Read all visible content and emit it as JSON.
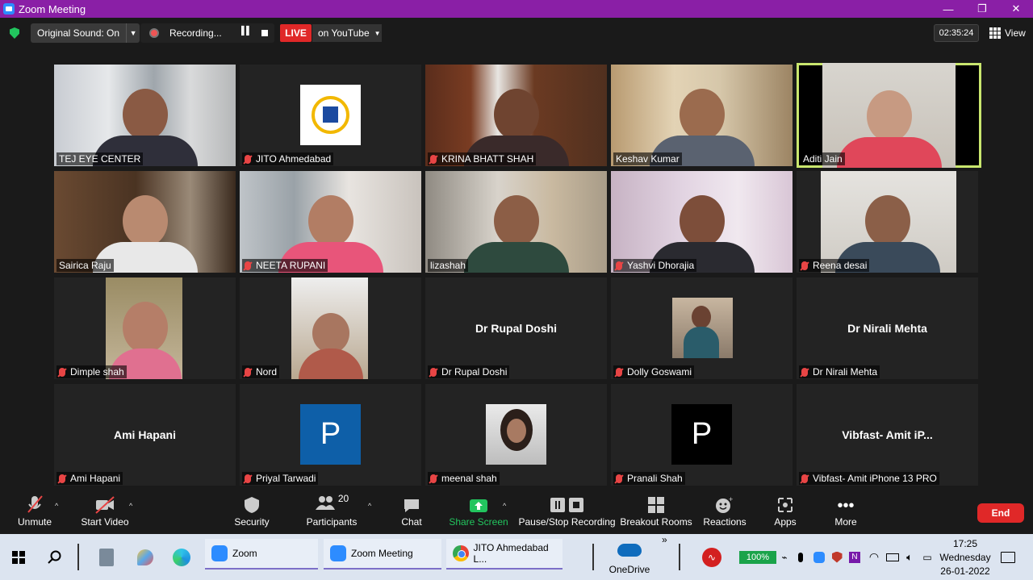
{
  "window": {
    "title": "Zoom Meeting",
    "minimize": "—",
    "maximize": "❐",
    "close": "✕"
  },
  "topbar": {
    "original_sound": "Original Sound: On",
    "recording": "Recording...",
    "live": "LIVE",
    "stream_target": "on YouTube",
    "timer": "02:35:24",
    "view": "View"
  },
  "tiles": [
    {
      "name": "TEJ EYE CENTER",
      "muted": false
    },
    {
      "name": "JITO Ahmedabad",
      "muted": true
    },
    {
      "name": "KRINA BHATT SHAH",
      "muted": true
    },
    {
      "name": "Keshav Kumar",
      "muted": false
    },
    {
      "name": "Aditi Jain",
      "muted": false,
      "active": true
    },
    {
      "name": "Sairica Raju",
      "muted": false
    },
    {
      "name": "NEETA RUPANI",
      "muted": true
    },
    {
      "name": "lizashah",
      "muted": false
    },
    {
      "name": "Yashvi Dhorajia",
      "muted": true
    },
    {
      "name": "Reena desai",
      "muted": true
    },
    {
      "name": "Dimple shah",
      "muted": true
    },
    {
      "name": "Nord",
      "muted": true
    },
    {
      "name": "Dr Rupal Doshi",
      "muted": true,
      "display_name": "Dr Rupal Doshi"
    },
    {
      "name": "Dolly Goswami",
      "muted": true
    },
    {
      "name": "Dr Nirali Mehta",
      "muted": true,
      "display_name": "Dr Nirali Mehta"
    },
    {
      "name": "Ami Hapani",
      "muted": true,
      "display_name": "Ami Hapani"
    },
    {
      "name": "Priyal Tarwadi",
      "muted": true,
      "avatar_letter": "P",
      "avatar_color": "#0e5fa8"
    },
    {
      "name": "meenal shah",
      "muted": true
    },
    {
      "name": "Pranali Shah",
      "muted": true,
      "avatar_letter": "P",
      "avatar_color": "#000000"
    },
    {
      "name": "Vibfast- Amit iPhone 13 PRO",
      "muted": true,
      "display_name": "Vibfast- Amit iP..."
    }
  ],
  "toolbar": {
    "unmute": "Unmute",
    "start_video": "Start Video",
    "security": "Security",
    "participants": "Participants",
    "participants_count": "20",
    "chat": "Chat",
    "share_screen": "Share Screen",
    "pause_stop_recording": "Pause/Stop Recording",
    "breakout_rooms": "Breakout Rooms",
    "reactions": "Reactions",
    "apps": "Apps",
    "more": "More",
    "end": "End"
  },
  "taskbar": {
    "apps": [
      {
        "label": "Zoom"
      },
      {
        "label": "Zoom Meeting"
      },
      {
        "label": "JITO Ahmedabad L..."
      }
    ],
    "overflow": "»",
    "onedrive": "OneDrive",
    "battery": "100%",
    "time": "17:25",
    "day": "Wednesday",
    "date": "26-01-2022"
  },
  "colors": {
    "title_bar": "#8a1fa6",
    "live": "#e02828",
    "share_green": "#22c55e",
    "end": "#e02828",
    "active_border": "#c9e66e"
  }
}
